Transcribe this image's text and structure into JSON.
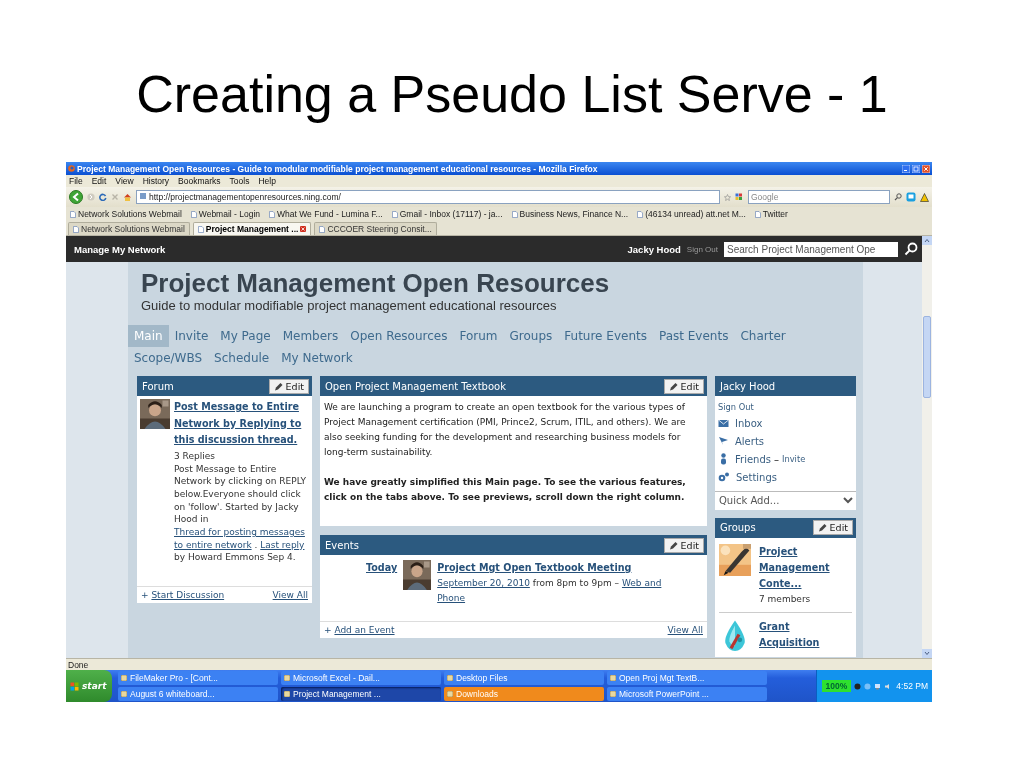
{
  "slide": {
    "title": "Creating a Pseudo List Serve - 1"
  },
  "browser": {
    "window_title": "Project Management Open Resources - Guide to modular modifiable project management educational resources - Mozilla Firefox",
    "menu": [
      "File",
      "Edit",
      "View",
      "History",
      "Bookmarks",
      "Tools",
      "Help"
    ],
    "url": "http://projectmanagementopenresources.ning.com/",
    "search_placeholder": "Google",
    "bookmarks": [
      "Network Solutions Webmail",
      "Webmail - Login",
      "What We Fund - Lumina F...",
      "Gmail - Inbox (17117) - ja...",
      "Business News, Finance N...",
      "(46134 unread) att.net M...",
      "Twitter"
    ],
    "tabs": [
      {
        "label": "Network Solutions Webmail",
        "selected": false
      },
      {
        "label": "Project Management ...",
        "selected": true
      },
      {
        "label": "CCCOER Steering Consit...",
        "selected": false
      }
    ],
    "status": "Done"
  },
  "site": {
    "topbar": {
      "title": "Manage My Network",
      "user": "Jacky Hood",
      "sign_out": "Sign Out",
      "search_placeholder": "Search Project Management Ope"
    },
    "header": {
      "title": "Project Management Open Resources",
      "subtitle": "Guide to modular modifiable project management educational resources"
    },
    "nav": [
      {
        "label": "Main",
        "selected": true
      },
      {
        "label": "Invite",
        "selected": false
      },
      {
        "label": "My Page",
        "selected": false
      },
      {
        "label": "Members",
        "selected": false
      },
      {
        "label": "Open Resources",
        "selected": false
      },
      {
        "label": "Forum",
        "selected": false
      },
      {
        "label": "Groups",
        "selected": false
      },
      {
        "label": "Future Events",
        "selected": false
      },
      {
        "label": "Past Events",
        "selected": false
      },
      {
        "label": "Charter",
        "selected": false
      },
      {
        "label": "Scope/WBS",
        "selected": false
      },
      {
        "label": "Schedule",
        "selected": false
      },
      {
        "label": "My Network",
        "selected": false
      }
    ],
    "forum": {
      "title": "Forum",
      "edit": "Edit",
      "post_title": "Post Message to Entire Network by Replying to this discussion thread.",
      "replies": "3 Replies",
      "summary": [
        {
          "kind": "text",
          "text": "Post Message to Entire Network by clicking on REPLY below.Everyone should click on 'follow'. Started by Jacky Hood in"
        },
        {
          "kind": "link",
          "text": "Thread for posting messages"
        },
        {
          "kind": "link",
          "text": "to entire network"
        },
        {
          "kind": "text",
          "text": "."
        },
        {
          "kind": "link",
          "text": "Last reply"
        },
        {
          "kind": "text",
          "text": "by Howard Emmons Sep 4."
        }
      ],
      "add": {
        "sign": "+",
        "label": "Start Discussion"
      },
      "view_all": "View All"
    },
    "textbook": {
      "title": "Open Project Management Textbook",
      "edit": "Edit",
      "paragraphs": [
        {
          "text": "We are launching a program to create an open textbook for the various types of Project Management certification (PMI, Prince2, Scrum, ITIL, and others). We are also seeking funding for the development and researching business models for long-term sustainability.",
          "bold": false
        },
        {
          "text": "We have greatly simplified this Main page. To see the various features, click on the tabs above. To see previews, scroll down the right column.",
          "bold": true
        }
      ]
    },
    "events": {
      "title": "Events",
      "edit": "Edit",
      "items": [
        {
          "day": "Today",
          "title": "Project Mgt Open Textbook Meeting",
          "details": [
            {
              "kind": "link",
              "text": "September 20, 2010"
            },
            {
              "kind": "text",
              "text": "from 8pm to 9pm –"
            },
            {
              "kind": "link",
              "text": "Web and"
            },
            {
              "kind": "link",
              "text": "Phone"
            }
          ]
        }
      ],
      "add": {
        "sign": "+",
        "label": "Add an Event"
      },
      "view_all": "View All"
    },
    "profile": {
      "title": "Jacky Hood",
      "sign_out": "Sign Out",
      "links": [
        {
          "label": "Inbox",
          "kind": "inbox"
        },
        {
          "label": "Alerts",
          "kind": "alerts"
        },
        {
          "label": "Friends",
          "kind": "friends",
          "separator": "–",
          "extra": "Invite"
        },
        {
          "label": "Settings",
          "kind": "settings"
        }
      ],
      "quick_add": "Quick Add..."
    },
    "groups": {
      "title": "Groups",
      "edit": "Edit",
      "items": [
        {
          "name": "Project Management Conte...",
          "members": "7 members",
          "kind": "pen"
        },
        {
          "name": "Grant Acquisition",
          "kind": "drop"
        }
      ]
    }
  },
  "taskbar": {
    "start": "start",
    "items": [
      {
        "label": "FileMaker Pro - [Cont...",
        "selected": false,
        "attention": false
      },
      {
        "label": "Microsoft Excel - Dail...",
        "selected": false,
        "attention": false
      },
      {
        "label": "Desktop Files",
        "selected": false,
        "attention": false
      },
      {
        "label": "Open Proj Mgt TextB...",
        "selected": false,
        "attention": false
      },
      {
        "label": "August 6 whiteboard...",
        "selected": false,
        "attention": false
      },
      {
        "label": "Project Management ...",
        "selected": true,
        "attention": false
      },
      {
        "label": "Downloads",
        "selected": false,
        "attention": true
      },
      {
        "label": "Microsoft PowerPoint ...",
        "selected": false,
        "attention": false
      }
    ],
    "battery": "100%",
    "clock": "4:52 PM"
  }
}
